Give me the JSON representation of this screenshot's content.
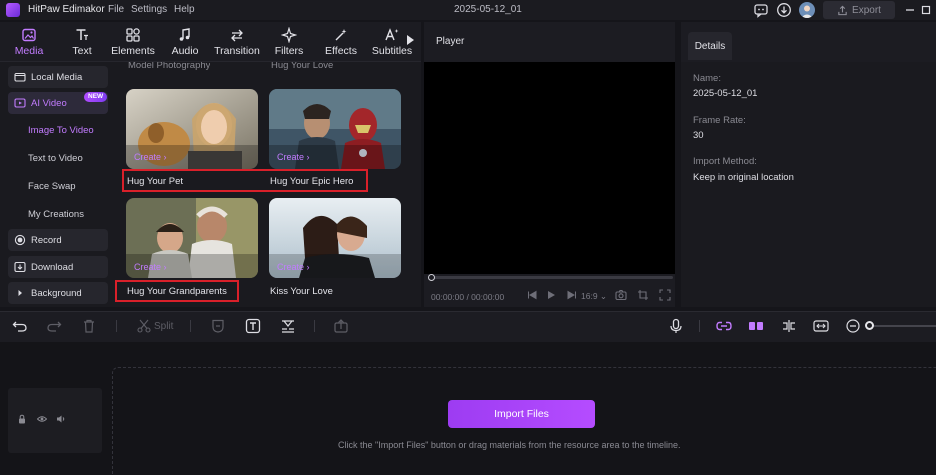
{
  "app": {
    "name": "HitPaw Edimakor",
    "doc_title": "2025-05-12_01"
  },
  "menu": [
    "File",
    "Settings",
    "Help"
  ],
  "titlebar": {
    "export_label": "Export"
  },
  "tool_tabs": [
    "Media",
    "Text",
    "Elements",
    "Audio",
    "Transition",
    "Filters",
    "Effects",
    "Subtitles"
  ],
  "left_nav": {
    "local_media": "Local Media",
    "ai_video": "AI Video",
    "new_badge": "NEW",
    "sub_items": [
      "Image To Video",
      "Text to Video",
      "Face Swap",
      "My Creations"
    ],
    "record": "Record",
    "download": "Download",
    "background": "Background"
  },
  "media_grid": {
    "cut_titles": [
      "Model Photography",
      "Hug Your Love"
    ],
    "create_label": "Create",
    "cards": [
      {
        "label": "Hug Your Pet",
        "highlighted": true
      },
      {
        "label": "Hug Your Epic Hero",
        "highlighted": true
      },
      {
        "label": "Hug Your Grandparents",
        "highlighted": true
      },
      {
        "label": "Kiss Your Love",
        "highlighted": false
      }
    ]
  },
  "player": {
    "label": "Player",
    "timecode": "00:00:00 / 00:00:00",
    "ratio": "16:9",
    "progress": 0
  },
  "details": {
    "tab": "Details",
    "fields": [
      {
        "label": "Name:",
        "value": "2025-05-12_01"
      },
      {
        "label": "Frame Rate:",
        "value": "30"
      },
      {
        "label": "Import Method:",
        "value": "Keep in original location"
      }
    ]
  },
  "edit_toolbar": {
    "split_label": "Split"
  },
  "timeline": {
    "import_label": "Import Files",
    "hint": "Click the \"Import Files\" button or drag materials from the resource area to the timeline."
  },
  "colors": {
    "accent": "#c27cff",
    "highlight_box": "#d9202a",
    "import_button": "#a945f7"
  }
}
